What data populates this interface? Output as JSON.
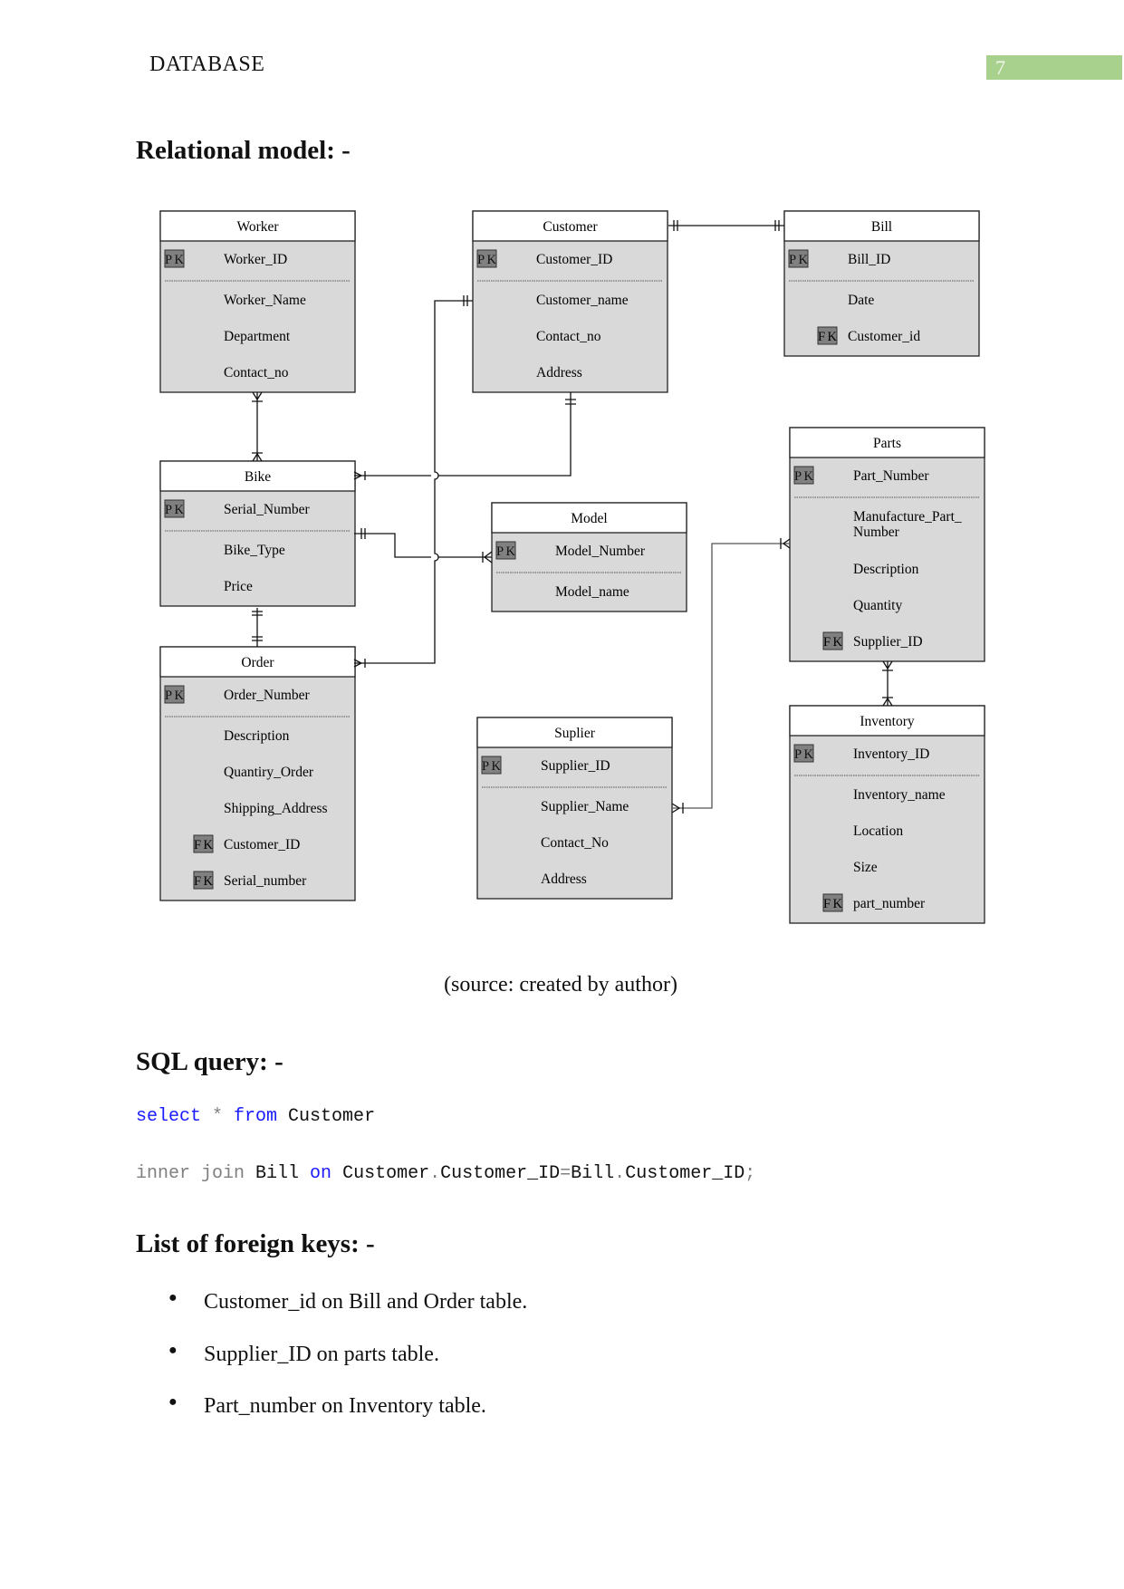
{
  "header": {
    "title": "DATABASE",
    "page_number": "7",
    "page_badge_color": "#a9d18e"
  },
  "sections": {
    "relational_heading": "Relational model: -",
    "caption": "(source: created by author)",
    "sql_heading": "SQL query: -",
    "fk_heading": "List of foreign keys: -"
  },
  "sql": {
    "line1": [
      {
        "t": "select",
        "c": "kw"
      },
      {
        "t": " * ",
        "c": "gr"
      },
      {
        "t": "from",
        "c": "kw"
      },
      {
        "t": " Customer",
        "c": ""
      }
    ],
    "line2": [
      {
        "t": "inner join",
        "c": "gr"
      },
      {
        "t": " Bill ",
        "c": ""
      },
      {
        "t": "on",
        "c": "kw"
      },
      {
        "t": " Customer",
        "c": ""
      },
      {
        "t": ".",
        "c": "gr"
      },
      {
        "t": "Customer_ID",
        "c": ""
      },
      {
        "t": "=",
        "c": "gr"
      },
      {
        "t": "Bill",
        "c": ""
      },
      {
        "t": ".",
        "c": "gr"
      },
      {
        "t": "Customer_ID",
        "c": ""
      },
      {
        "t": ";",
        "c": "gr"
      }
    ]
  },
  "foreign_keys": [
    "Customer_id on Bill and Order table.",
    "Supplier_ID on parts table.",
    "Part_number on Inventory table."
  ],
  "diagram": {
    "pk_label": "PK",
    "fk_label": "FK",
    "entity_fill": "#d9d9d9",
    "entities": [
      {
        "id": "worker",
        "name": "Worker",
        "pk": "Worker_ID",
        "attrs": [
          {
            "n": "Worker_Name"
          },
          {
            "n": "Department"
          },
          {
            "n": "Contact_no"
          }
        ]
      },
      {
        "id": "customer",
        "name": "Customer",
        "pk": "Customer_ID",
        "attrs": [
          {
            "n": "Customer_name"
          },
          {
            "n": "Contact_no"
          },
          {
            "n": "Address"
          }
        ]
      },
      {
        "id": "bill",
        "name": "Bill",
        "pk": "Bill_ID",
        "attrs": [
          {
            "n": "Date"
          },
          {
            "n": "Customer_id",
            "fk": true
          }
        ]
      },
      {
        "id": "bike",
        "name": "Bike",
        "pk": "Serial_Number",
        "attrs": [
          {
            "n": "Bike_Type"
          },
          {
            "n": "Price"
          }
        ]
      },
      {
        "id": "model",
        "name": "Model",
        "pk": "Model_Number",
        "attrs": [
          {
            "n": "Model_name"
          }
        ]
      },
      {
        "id": "parts",
        "name": "Parts",
        "pk": "Part_Number",
        "attrs": [
          {
            "n": "Manufacture_Part_",
            "n2": "Number"
          },
          {
            "n": "Description"
          },
          {
            "n": "Quantity"
          },
          {
            "n": "Supplier_ID",
            "fk": true
          }
        ]
      },
      {
        "id": "order",
        "name": "Order",
        "pk": "Order_Number",
        "attrs": [
          {
            "n": "Description"
          },
          {
            "n": "Quantiry_Order"
          },
          {
            "n": "Shipping_Address"
          },
          {
            "n": "Customer_ID",
            "fk": true
          },
          {
            "n": "Serial_number",
            "fk": true
          }
        ]
      },
      {
        "id": "suplier",
        "name": "Suplier",
        "pk": "Supplier_ID",
        "attrs": [
          {
            "n": "Supplier_Name"
          },
          {
            "n": "Contact_No"
          },
          {
            "n": "Address"
          }
        ]
      },
      {
        "id": "inventory",
        "name": "Inventory",
        "pk": "Inventory_ID",
        "attrs": [
          {
            "n": "Inventory_name"
          },
          {
            "n": "Location"
          },
          {
            "n": "Size"
          },
          {
            "n": "part_number",
            "fk": true
          }
        ]
      }
    ],
    "relationships": [
      {
        "from": "Customer",
        "to": "Bill"
      },
      {
        "from": "Customer",
        "to": "Order"
      },
      {
        "from": "Customer",
        "to": "Bike"
      },
      {
        "from": "Bike",
        "to": "Model"
      },
      {
        "from": "Worker",
        "to": "Bike"
      },
      {
        "from": "Bike",
        "to": "Order"
      },
      {
        "from": "Suplier",
        "to": "Parts"
      },
      {
        "from": "Parts",
        "to": "Inventory"
      }
    ]
  }
}
